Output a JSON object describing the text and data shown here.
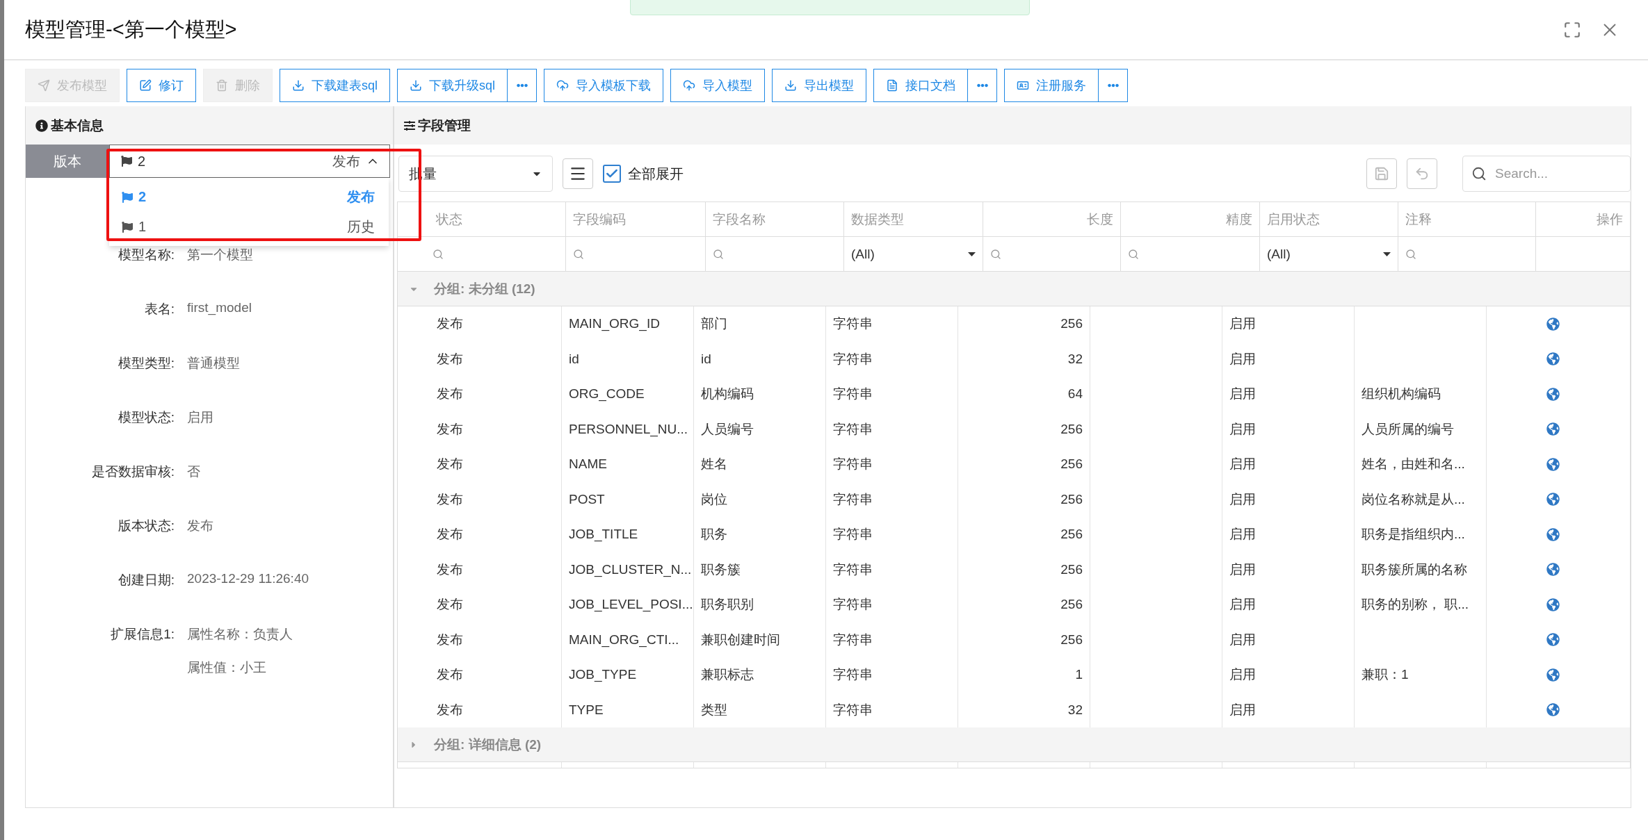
{
  "window": {
    "title": "模型管理-<第一个模型>"
  },
  "toolbar": [
    {
      "label": "发布模型",
      "disabled": true,
      "more": false
    },
    {
      "label": "修订",
      "disabled": false,
      "more": false
    },
    {
      "label": "删除",
      "disabled": true,
      "more": false
    },
    {
      "label": "下载建表sql",
      "disabled": false,
      "more": false
    },
    {
      "label": "下载升级sql",
      "disabled": false,
      "more": true
    },
    {
      "label": "导入模板下载",
      "disabled": false,
      "more": false
    },
    {
      "label": "导入模型",
      "disabled": false,
      "more": false
    },
    {
      "label": "导出模型",
      "disabled": false,
      "more": false
    },
    {
      "label": "接口文档",
      "disabled": false,
      "more": true
    },
    {
      "label": "注册服务",
      "disabled": false,
      "more": true
    }
  ],
  "info_panel": {
    "title": "基本信息",
    "version": {
      "label": "版本",
      "value": "2",
      "status": "发布",
      "expanded": true,
      "options": [
        {
          "number": "2",
          "status": "发布",
          "selected": true
        },
        {
          "number": "1",
          "status": "历史",
          "selected": false
        }
      ]
    },
    "fields": [
      {
        "label": "模型名称:",
        "values": [
          "第一个模型"
        ]
      },
      {
        "label": "表名:",
        "values": [
          "first_model"
        ]
      },
      {
        "label": "模型类型:",
        "values": [
          "普通模型"
        ]
      },
      {
        "label": "模型状态:",
        "values": [
          "启用"
        ]
      },
      {
        "label": "是否数据审核:",
        "values": [
          "否"
        ]
      },
      {
        "label": "版本状态:",
        "values": [
          "发布"
        ]
      },
      {
        "label": "创建日期:",
        "values": [
          "2023-12-29 11:26:40"
        ]
      },
      {
        "label": "扩展信息1:",
        "values": [
          "属性名称：负责人",
          "属性值：小王"
        ]
      }
    ]
  },
  "fields_panel": {
    "title": "字段管理",
    "batch_select": "批量",
    "expand_all": {
      "label": "全部展开",
      "checked": true
    },
    "search": {
      "placeholder": "Search..."
    },
    "columns": [
      "状态",
      "字段编码",
      "字段名称",
      "数据类型",
      "长度",
      "精度",
      "启用状态",
      "注释",
      "操作"
    ],
    "filters": [
      {
        "kind": "search"
      },
      {
        "kind": "search"
      },
      {
        "kind": "search"
      },
      {
        "kind": "select",
        "value": "(All)"
      },
      {
        "kind": "search"
      },
      {
        "kind": "search"
      },
      {
        "kind": "select",
        "value": "(All)"
      },
      {
        "kind": "search"
      },
      {
        "kind": "none"
      }
    ],
    "groups": [
      {
        "label": "分组: 未分组 (12)",
        "expanded": true,
        "rows": [
          [
            "发布",
            "MAIN_ORG_ID",
            "部门",
            "字符串",
            "256",
            "",
            "启用",
            ""
          ],
          [
            "发布",
            "id",
            "id",
            "字符串",
            "32",
            "",
            "启用",
            ""
          ],
          [
            "发布",
            "ORG_CODE",
            "机构编码",
            "字符串",
            "64",
            "",
            "启用",
            "组织机构编码"
          ],
          [
            "发布",
            "PERSONNEL_NU...",
            "人员编号",
            "字符串",
            "256",
            "",
            "启用",
            "人员所属的编号"
          ],
          [
            "发布",
            "NAME",
            "姓名",
            "字符串",
            "256",
            "",
            "启用",
            "姓名，由姓和名..."
          ],
          [
            "发布",
            "POST",
            "岗位",
            "字符串",
            "256",
            "",
            "启用",
            "岗位名称就是从..."
          ],
          [
            "发布",
            "JOB_TITLE",
            "职务",
            "字符串",
            "256",
            "",
            "启用",
            "职务是指组织内..."
          ],
          [
            "发布",
            "JOB_CLUSTER_N...",
            "职务簇",
            "字符串",
            "256",
            "",
            "启用",
            "职务簇所属的名称"
          ],
          [
            "发布",
            "JOB_LEVEL_POSI...",
            "职务职别",
            "字符串",
            "256",
            "",
            "启用",
            "职务的别称， 职..."
          ],
          [
            "发布",
            "MAIN_ORG_CTI...",
            "兼职创建时间",
            "字符串",
            "256",
            "",
            "启用",
            ""
          ],
          [
            "发布",
            "JOB_TYPE",
            "兼职标志",
            "字符串",
            "1",
            "",
            "启用",
            "兼职：1"
          ],
          [
            "发布",
            "TYPE",
            "类型",
            "字符串",
            "32",
            "",
            "启用",
            ""
          ]
        ]
      },
      {
        "label": "分组: 详细信息 (2)",
        "expanded": false
      }
    ]
  }
}
